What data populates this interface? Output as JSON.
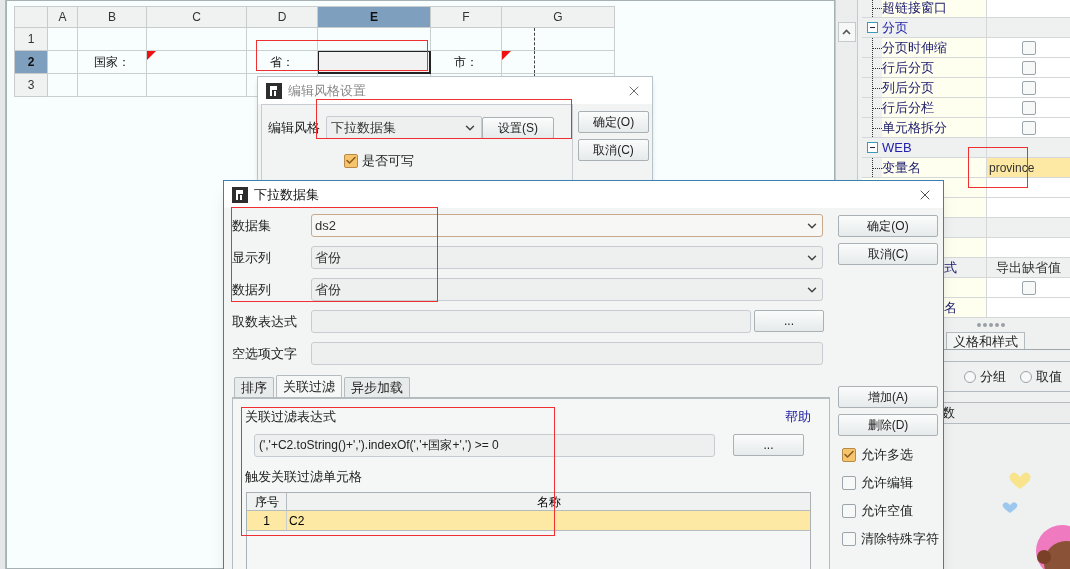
{
  "sheet": {
    "columns": [
      {
        "label": "A",
        "selected": false
      },
      {
        "label": "B",
        "selected": false
      },
      {
        "label": "C",
        "selected": false
      },
      {
        "label": "D",
        "selected": false
      },
      {
        "label": "E",
        "selected": true
      },
      {
        "label": "F",
        "selected": false
      },
      {
        "label": "G",
        "selected": false
      }
    ],
    "rows": [
      {
        "label": "1",
        "selected": false,
        "cells": [
          {
            "selected": false,
            "corner_mark": false
          },
          {
            "selected": false,
            "corner_mark": false
          },
          {
            "selected": false,
            "corner_mark": false
          },
          {
            "selected": false,
            "corner_mark": false
          },
          {
            "selected": false,
            "corner_mark": false
          },
          {
            "selected": false,
            "corner_mark": false
          },
          {
            "selected": false,
            "corner_mark": false
          }
        ]
      },
      {
        "label": "2",
        "selected": true,
        "cells": [
          {
            "selected": false,
            "corner_mark": false
          },
          {
            "text": "国家：",
            "selected": false,
            "corner_mark": false
          },
          {
            "selected": false,
            "corner_mark": true
          },
          {
            "text": "省：",
            "selected": false,
            "corner_mark": false
          },
          {
            "selected": true,
            "corner_mark": false
          },
          {
            "text": "市：",
            "selected": false,
            "corner_mark": false
          },
          {
            "selected": false,
            "corner_mark": true
          }
        ]
      },
      {
        "label": "3",
        "selected": false,
        "cells": [
          {
            "selected": false,
            "corner_mark": false
          },
          {
            "selected": false,
            "corner_mark": false
          },
          {
            "selected": false,
            "corner_mark": false
          },
          {
            "selected": false,
            "corner_mark": false
          },
          {
            "selected": false,
            "corner_mark": false
          },
          {
            "selected": false,
            "corner_mark": false
          },
          {
            "selected": false,
            "corner_mark": false
          }
        ]
      }
    ]
  },
  "properties": [
    {
      "kind": "leaf",
      "label": "超链接窗口"
    },
    {
      "kind": "group",
      "label": "分页",
      "expanded": true,
      "children": [
        {
          "kind": "checkbox",
          "label": "分页时伸缩",
          "checked": false
        },
        {
          "kind": "checkbox",
          "label": "行后分页",
          "checked": false
        },
        {
          "kind": "checkbox",
          "label": "列后分页",
          "checked": false
        },
        {
          "kind": "checkbox",
          "label": "行后分栏",
          "checked": false
        },
        {
          "kind": "checkbox",
          "label": "单元格拆分",
          "checked": false
        }
      ]
    },
    {
      "kind": "group",
      "label": "WEB",
      "expanded": true,
      "children": [
        {
          "kind": "text",
          "label": "变量名",
          "value": "province",
          "selected": true
        }
      ]
    }
  ],
  "more_properties": [
    {
      "kind": "blank"
    },
    {
      "kind": "blank"
    },
    {
      "kind": "group_blank"
    },
    {
      "kind": "blank"
    },
    {
      "kind": "header",
      "label": "式",
      "value": "导出缺省值"
    },
    {
      "kind": "checkbox",
      "checked": false
    },
    {
      "kind": "text",
      "label": "名"
    }
  ],
  "lower_panel": {
    "tab": "义格和样式",
    "radios": [
      {
        "label": "分组",
        "selected": false
      },
      {
        "label": "取值",
        "selected": false
      }
    ],
    "field_label": "数"
  },
  "style_dialog": {
    "title": "编辑风格设置",
    "style_label": "编辑风格",
    "style_value": "下拉数据集",
    "settings_button": "设置(S)",
    "ok_button": "确定(O)",
    "cancel_button": "取消(C)",
    "writable": {
      "label": "是否可写",
      "checked": true
    }
  },
  "dataset_dialog": {
    "title": "下拉数据集",
    "fields": [
      {
        "kind": "select",
        "label": "数据集",
        "value": "ds2",
        "focused": true
      },
      {
        "kind": "select",
        "label": "显示列",
        "value": "省份",
        "focused": false
      },
      {
        "kind": "select",
        "label": "数据列",
        "value": "省份",
        "focused": false
      },
      {
        "kind": "expression",
        "label": "取数表达式",
        "button": "...",
        "focused": false
      },
      {
        "kind": "text",
        "label": "空选项文字",
        "focused": false
      }
    ],
    "tabs": [
      {
        "label": "排序",
        "selected": false
      },
      {
        "label": "关联过滤",
        "selected": true
      },
      {
        "label": "异步加载",
        "selected": false
      }
    ],
    "filter": {
      "expression_label": "关联过滤表达式",
      "help_link": "帮助",
      "expression": "(','+C2.toString()+',').indexOf(','+国家+',') >= 0",
      "expression_button": "...",
      "cells_label": "触发关联过滤单元格",
      "table": {
        "columns": [
          "序号",
          "名称"
        ],
        "rows": [
          {
            "index": "1",
            "name": "C2",
            "selected": true
          }
        ]
      }
    },
    "action_buttons": [
      "确定(O)",
      "取消(C)"
    ],
    "list_buttons": [
      "增加(A)",
      "删除(D)"
    ],
    "options": [
      {
        "label": "允许多选",
        "checked": true
      },
      {
        "label": "允许编辑",
        "checked": false
      },
      {
        "label": "允许空值",
        "checked": false
      },
      {
        "label": "清除特殊字符",
        "checked": false
      }
    ]
  }
}
